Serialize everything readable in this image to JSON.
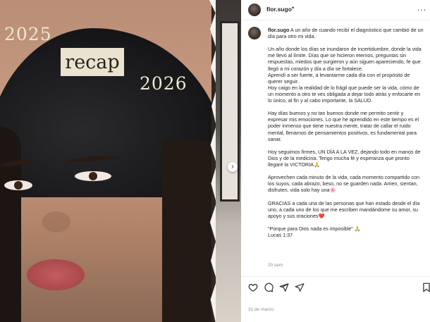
{
  "post": {
    "username": "flor.sugo",
    "header_dot": "•",
    "more": "...",
    "caption_paragraphs": [
      "A un año de cuando recibí el diagnóstico que cambió de un día para otro mi vida.",
      "Un año donde los días se inundaron de incertidumbre, donde la vida me llevó al límite. Días que se hicieron eternos, preguntas sin respuestas, miedos que surgieron y aún siguen apareciendo, fe que llegó a mi corazón y día a día se fortalece.\nAprendí a ser fuerte, a levantarme cada día con el propósito de querer seguir.\nHoy caigo en la realidad de lo frágil que puede ser la vida, cómo de un momento a otro te ves obligada a dejar todo atrás y enfocarte en lo único, al fin y al cabo importante, la SALUD.",
      "Hay días buenos y no tan buenos donde me permito sentir y expresar mis emociones. Lo que he aprendido en este tiempo es el poder inmenso que tiene nuestra mente, tratar de callar el ruido mental, llenarnos de pensamientos positivos, es fundamental para sanar.",
      "Hoy seguimos firmes, UN DÍA A LA VEZ, dejando todo en manos de Dios y de la medicina. Tengo mucha fé y esperanza que pronto llegaré la VICTORIA🙏",
      "Aprovechen cada minuto de la vida, cada momento compartido con los suyos, cada abrazo, beso, no se guarden nada. Amen, sientan, disfruten, vida solo hay una🌸",
      "GRACIAS a cada una de las personas que han estado desde el día uno, a cada uno de los que me escriben mandándome su amor, su apoyo y sus oraciones❤️",
      "“Porque para Dios nada es imposible” 🙏\nLucas 1:37"
    ],
    "time_ago": "20 sem",
    "date": "31 de marzo"
  },
  "media": {
    "year_start": "2025",
    "recap": "recap",
    "year_end": "2026",
    "next_arrow": "›"
  },
  "icons": [
    "heart-icon",
    "comment-icon",
    "share-icon",
    "bookmark-icon",
    "next-arrow-icon",
    "more-options-icon"
  ]
}
